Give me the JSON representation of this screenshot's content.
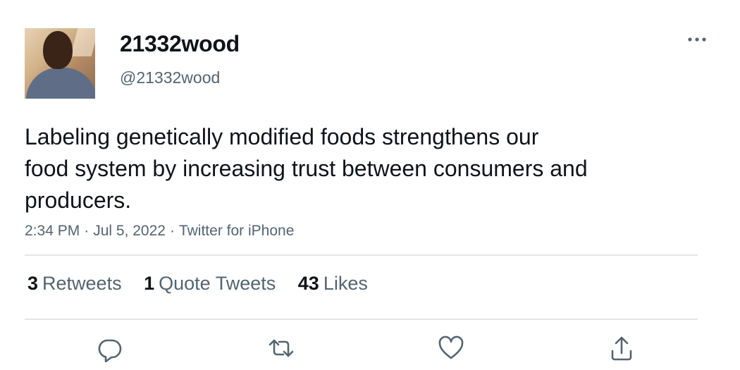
{
  "user": {
    "display_name": "21332wood",
    "handle": "@21332wood"
  },
  "tweet": {
    "text_lines": [
      "Labeling genetically modified foods strengthens our",
      "food system by increasing trust between consumers and",
      "producers."
    ],
    "time": "2:34 PM",
    "date": "Jul 5, 2022",
    "source": "Twitter for iPhone",
    "separator": "·"
  },
  "stats": {
    "retweets_count": "3",
    "retweets_label": "Retweets",
    "quotes_count": "1",
    "quotes_label": "Quote Tweets",
    "likes_count": "43",
    "likes_label": "Likes"
  },
  "icons": {
    "more": "more-horizontal-icon",
    "reply": "reply-icon",
    "retweet": "retweet-icon",
    "like": "like-icon",
    "share": "share-icon"
  },
  "colors": {
    "text_primary": "#0f1419",
    "text_secondary": "#536471",
    "divider": "#e3e5e8"
  }
}
